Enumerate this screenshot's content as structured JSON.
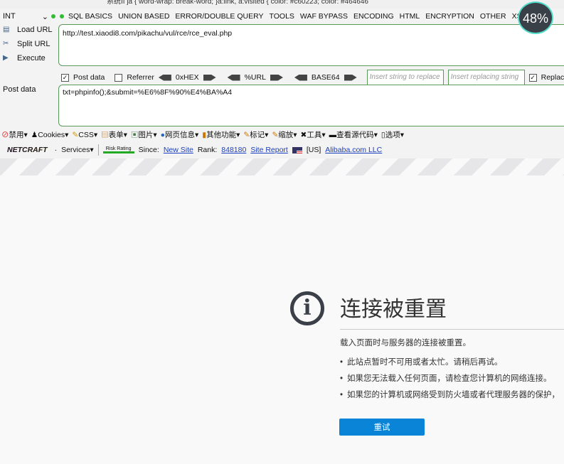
{
  "top_strip": "系统II     ja { word-wrap: break-word; }a:link, a:visited { color: #c60223; color: #464646",
  "hackbar": {
    "select": "INT",
    "menus": [
      "SQL BASICS",
      "UNION BASED",
      "ERROR/DOUBLE QUERY",
      "TOOLS",
      "WAF BYPASS",
      "ENCODING",
      "HTML",
      "ENCRYPTION",
      "OTHER",
      "XSS"
    ],
    "load_url": "Load URL",
    "split_url": "Split URL",
    "execute": "Execute",
    "url": "http://test.xiaodi8.com/pikachu/vul/rce/rce_eval.php",
    "post_data_label": "Post data",
    "referrer_label": "Referrer",
    "hex": "0xHEX",
    "urlenc": "%URL",
    "base64": "BASE64",
    "insert_placeholder": "Insert string to replace",
    "replacing_placeholder": "Insert replacing string",
    "replace_label": "Replace",
    "post_label": "Post data",
    "post_value": "txt=phpinfo();&submit=%E6%8F%90%E4%BA%A4"
  },
  "gauge": "48%",
  "toolbar": [
    "禁用",
    "Cookies",
    "CSS",
    "表单",
    "图片",
    "网页信息",
    "其他功能",
    "标记",
    "缩放",
    "工具",
    "查看源代码",
    "选项"
  ],
  "netcraft": {
    "logo": "NETCRAFT",
    "services": "Services",
    "risk": "Risk Rating",
    "since": "Since:",
    "new_site": "New Site",
    "rank": "Rank:",
    "rank_value": "848180",
    "site_report": "Site Report",
    "country": "[US]",
    "host": "Alibaba.com LLC"
  },
  "error": {
    "title": "连接被重置",
    "desc": "载入页面时与服务器的连接被重置。",
    "bullets": [
      "此站点暂时不可用或者太忙。请稍后再试。",
      "如果您无法载入任何页面，请检查您计算机的网络连接。",
      "如果您的计算机或网络受到防火墙或者代理服务器的保护，"
    ],
    "retry": "重试"
  }
}
